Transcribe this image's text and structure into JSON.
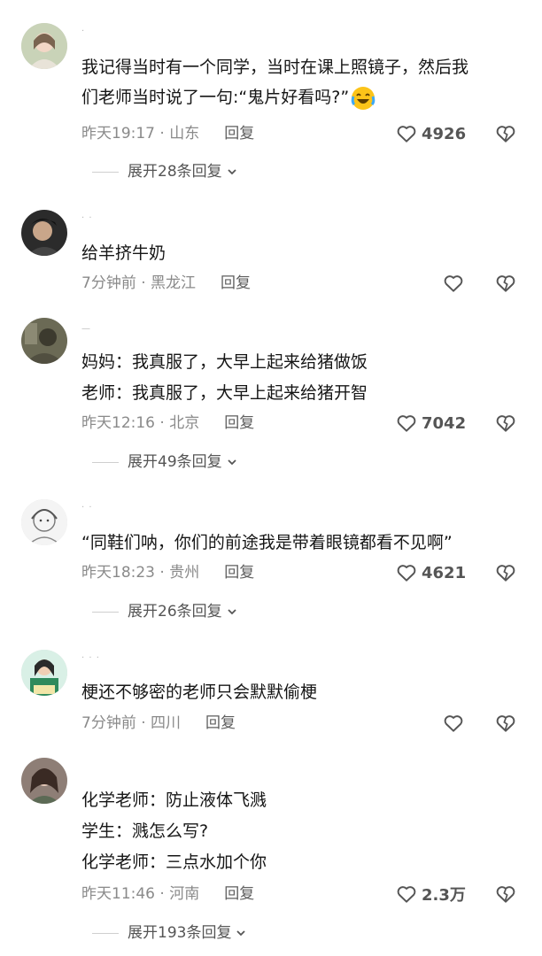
{
  "comments": [
    {
      "username": "·",
      "lines": [
        "我记得当时有一个同学，当时在课上照镜子，然后我",
        "们老师当时说了一句:“鬼片好看吗?”"
      ],
      "emoji": "crying-laughing-emoji",
      "time": "昨天19:17",
      "location": "山东",
      "reply": "回复",
      "likes": "4926",
      "expand": "展开28条回复"
    },
    {
      "username": "·  ·",
      "lines": [
        "给羊挤牛奶"
      ],
      "time": "7分钟前",
      "location": "黑龙江",
      "reply": "回复",
      "likes": "",
      "expand": ""
    },
    {
      "username": "—",
      "lines": [
        "妈妈：我真服了，大早上起来给猪做饭",
        "老师：我真服了，大早上起来给猪开智"
      ],
      "time": "昨天12:16",
      "location": "北京",
      "reply": "回复",
      "likes": "7042",
      "expand": "展开49条回复"
    },
    {
      "username": "·  ·",
      "lines": [
        "“同鞋们呐，你们的前途我是带着眼镜都看不见啊”"
      ],
      "time": "昨天18:23",
      "location": "贵州",
      "reply": "回复",
      "likes": "4621",
      "expand": "展开26条回复"
    },
    {
      "username": "·  · ·",
      "lines": [
        "梗还不够密的老师只会默默偷梗"
      ],
      "time": "7分钟前",
      "location": "四川",
      "reply": "回复",
      "likes": "",
      "expand": ""
    },
    {
      "username": "",
      "lines": [
        "化学老师：防止液体飞溅",
        "学生：溅怎么写?",
        "化学老师：三点水加个你"
      ],
      "time": "昨天11:46",
      "location": "河南",
      "reply": "回复",
      "likes": "2.3万",
      "expand": "展开193条回复"
    }
  ],
  "colors": {
    "text": "#161616",
    "meta": "#8a8a8a",
    "icon": "#555555"
  },
  "icons": {
    "like": "heart-outline-icon",
    "dislike": "broken-heart-icon",
    "expand": "chevron-down-icon"
  }
}
